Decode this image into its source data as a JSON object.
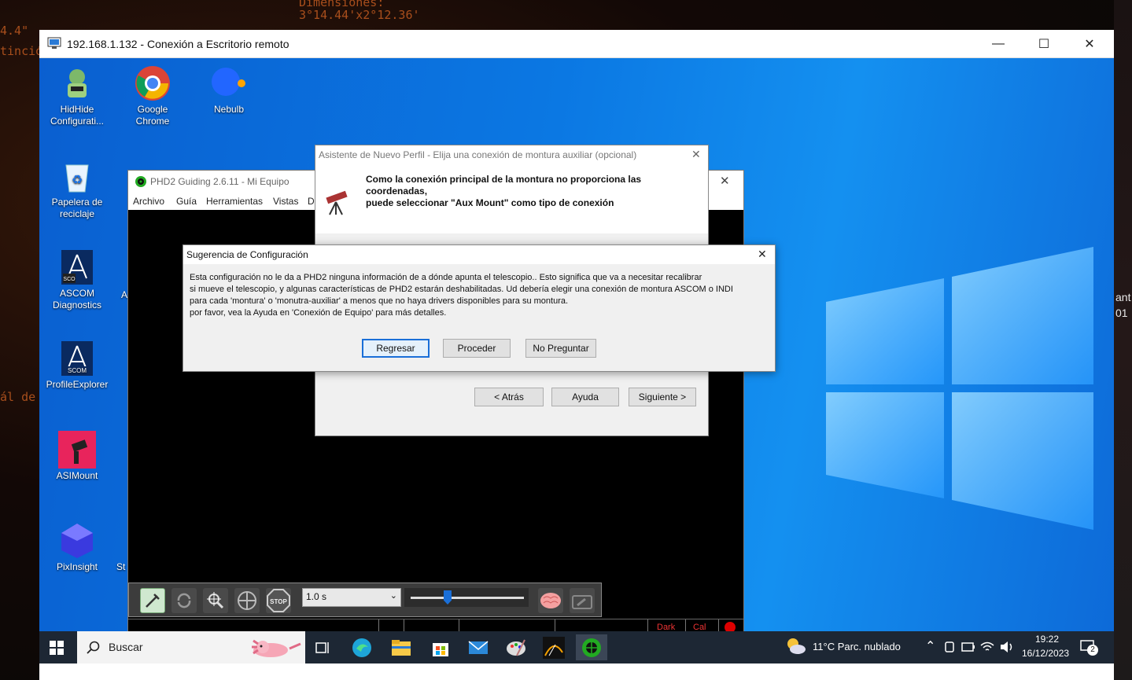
{
  "background": {
    "texts": [
      "Dimensiones:",
      "3°14.44'x2°12.36'",
      "4.4\"",
      "tinción",
      "ál de e",
      "ant",
      "01"
    ]
  },
  "rdp": {
    "title": "192.168.1.132 - Conexión a Escritorio remoto",
    "minimize_icon": "minimize-icon",
    "maximize_icon": "maximize-icon",
    "close_icon": "close-icon"
  },
  "desktop_icons": [
    {
      "label": "HidHide Configurati...",
      "icon": "hidhide-icon"
    },
    {
      "label": "Google Chrome",
      "icon": "chrome-icon"
    },
    {
      "label": "Nebulb",
      "icon": "nebulb-icon"
    },
    {
      "label": "Papelera de reciclaje",
      "icon": "recycle-bin-icon"
    },
    {
      "label": "ASCOM Diagnostics",
      "icon": "ascom-icon"
    },
    {
      "label": "ProfileExplorer",
      "icon": "ascom-profile-icon"
    },
    {
      "label": "ASIMount",
      "icon": "asimount-icon"
    },
    {
      "label": "PixInsight",
      "icon": "pixinsight-icon"
    }
  ],
  "partial_labels": {
    "a": "A",
    "st": "St"
  },
  "phd2": {
    "title": "PHD2 Guiding 2.6.11 - Mi Equipo",
    "menu": [
      "Archivo",
      "Guía",
      "Herramientas",
      "Vistas",
      "D"
    ],
    "exposure": "1.0 s",
    "status_dark": "Dark",
    "status_cal": "Cal"
  },
  "wizard": {
    "title": "Asistente de Nuevo Perfil - Elija una conexión de montura auxiliar (opcional)",
    "header_line1": "Como la conexión principal de la montura no proporciona las coordenadas,",
    "header_line2": "puede seleccionar \"Aux Mount\" como tipo de conexión",
    "back_label": "< Atrás",
    "help_label": "Ayuda",
    "next_label": "Siguiente >"
  },
  "config_dialog": {
    "title": "Sugerencia de Configuración",
    "line1": "Esta configuración no le da a PHD2 ninguna información de a dónde apunta el telescopio..  Esto significa que va a necesitar recalibrar",
    "line2": "si mueve el telescopio, y algunas características de PHD2 estarán deshabilitadas.  Ud debería elegir una conexión de montura ASCOM o INDI",
    "line3": "para cada 'montura' o 'monutra-auxiliar' a menos que no haya drivers disponibles para su montura.",
    "line4": "por favor, vea la Ayuda en 'Conexión de Equipo' para más detalles.",
    "back_label": "Regresar",
    "proceed_label": "Proceder",
    "dont_ask_label": "No Preguntar"
  },
  "taskbar": {
    "search_placeholder": "Buscar",
    "weather": "11°C  Parc. nublado",
    "time": "19:22",
    "date": "16/12/2023",
    "notification_count": "2"
  }
}
